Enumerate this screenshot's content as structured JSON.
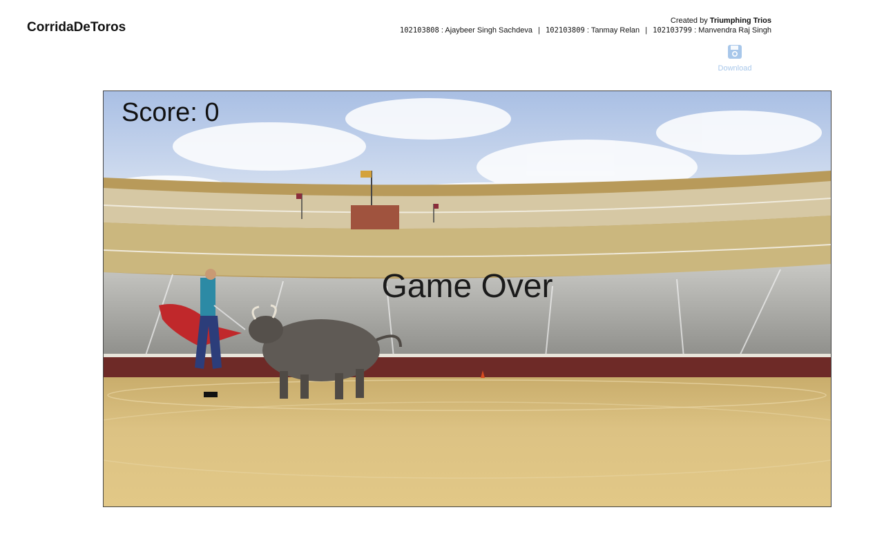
{
  "header": {
    "brand": "CorridaDeToros",
    "created_by_prefix": "Created by",
    "team_name": "Triumphing Trios",
    "members": [
      {
        "id": "102103808",
        "name": ": Ajaybeer Singh Sachdeva"
      },
      {
        "id": "102103809",
        "name": ": Tanmay Relan"
      },
      {
        "id": "102103799",
        "name": ": Manvendra Raj Singh"
      }
    ],
    "separator": "|"
  },
  "download": {
    "label": "Download",
    "icon": "save-disk-icon",
    "color": "#a8c7ea"
  },
  "game": {
    "score_label": "Score: 0",
    "status": "Game Over"
  }
}
